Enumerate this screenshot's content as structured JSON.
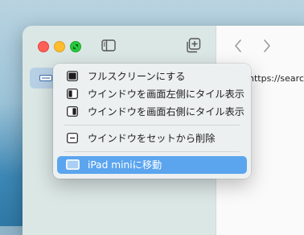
{
  "window": {
    "url_fragment": "https://searc"
  },
  "toolbar": {
    "icons": [
      "sidebar-icon",
      "new-tab-icon",
      "back-chevron-icon",
      "forward-chevron-icon"
    ]
  },
  "menu": {
    "items": [
      {
        "label": "フルスクリーンにする",
        "icon": "fullscreen-icon"
      },
      {
        "label": "ウインドウを画面左側にタイル表示",
        "icon": "tile-left-icon"
      },
      {
        "label": "ウインドウを画面右側にタイル表示",
        "icon": "tile-right-icon"
      },
      {
        "label": "ウインドウをセットから削除",
        "icon": "remove-from-set-icon"
      },
      {
        "label": "iPad miniに移動",
        "icon": "ipad-icon",
        "highlighted": true
      }
    ]
  },
  "colors": {
    "highlight": "#5ba5ef",
    "traffic_close": "#ff5f57",
    "traffic_minimize": "#febc2e",
    "traffic_zoom": "#28c840"
  }
}
